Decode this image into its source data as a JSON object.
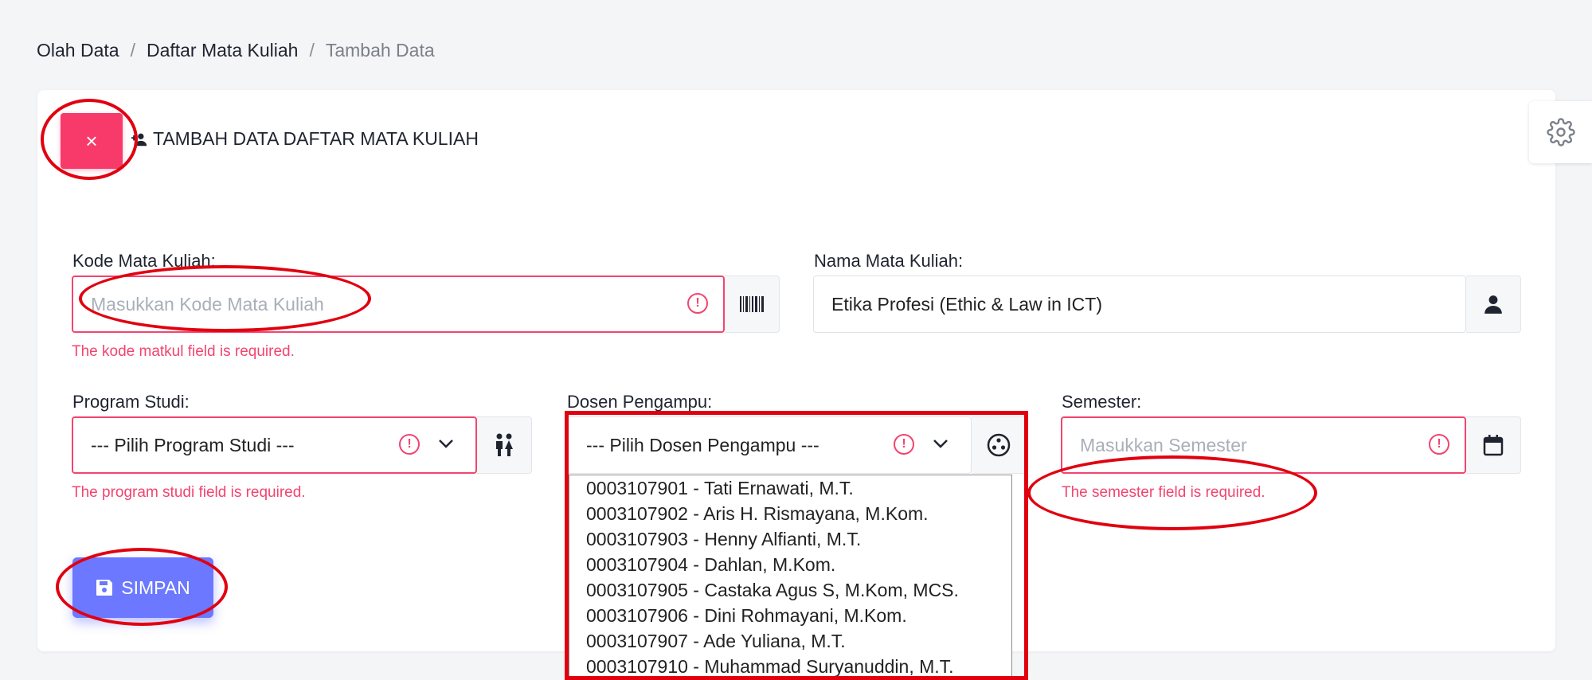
{
  "breadcrumb": {
    "items": [
      "Olah Data",
      "Daftar Mata Kuliah"
    ],
    "current": "Tambah Data",
    "separator": "/"
  },
  "card": {
    "title": "TAMBAH DATA DAFTAR MATA KULIAH",
    "close_symbol": "×"
  },
  "form": {
    "kode": {
      "label": "Kode Mata Kuliah:",
      "placeholder": "Masukkan Kode Mata Kuliah",
      "value": "",
      "error": "The kode matkul field is required.",
      "icon": "barcode-icon"
    },
    "nama": {
      "label": "Nama Mata Kuliah:",
      "value": "Etika Profesi (Ethic & Law in ICT)",
      "icon": "user-icon"
    },
    "prodi": {
      "label": "Program Studi:",
      "selected": "--- Pilih Program Studi ---",
      "error": "The program studi field is required.",
      "icon": "people-icon"
    },
    "dosen": {
      "label": "Dosen Pengampu:",
      "selected": "--- Pilih Dosen Pengampu ---",
      "icon": "palette-icon",
      "options": [
        "0003107901 - Tati Ernawati, M.T.",
        "0003107902 - Aris H. Rismayana, M.Kom.",
        "0003107903 - Henny Alfianti, M.T.",
        "0003107904 - Dahlan, M.Kom.",
        "0003107905 - Castaka Agus S, M.Kom, MCS.",
        "0003107906 - Dini Rohmayani, M.Kom.",
        "0003107907 - Ade Yuliana, M.T.",
        "0003107910 - Muhammad Suryanuddin, M.T."
      ]
    },
    "semester": {
      "label": "Semester:",
      "placeholder": "Masukkan Semester",
      "value": "",
      "error": "The semester field is required.",
      "icon": "calendar-icon"
    },
    "warning_symbol": "!"
  },
  "save_button": {
    "label": "SIMPAN",
    "icon": "save-icon"
  },
  "colors": {
    "error": "#f3446f",
    "primary": "#6b78ff",
    "danger": "#f83a6a",
    "annotation": "#e1000f"
  }
}
